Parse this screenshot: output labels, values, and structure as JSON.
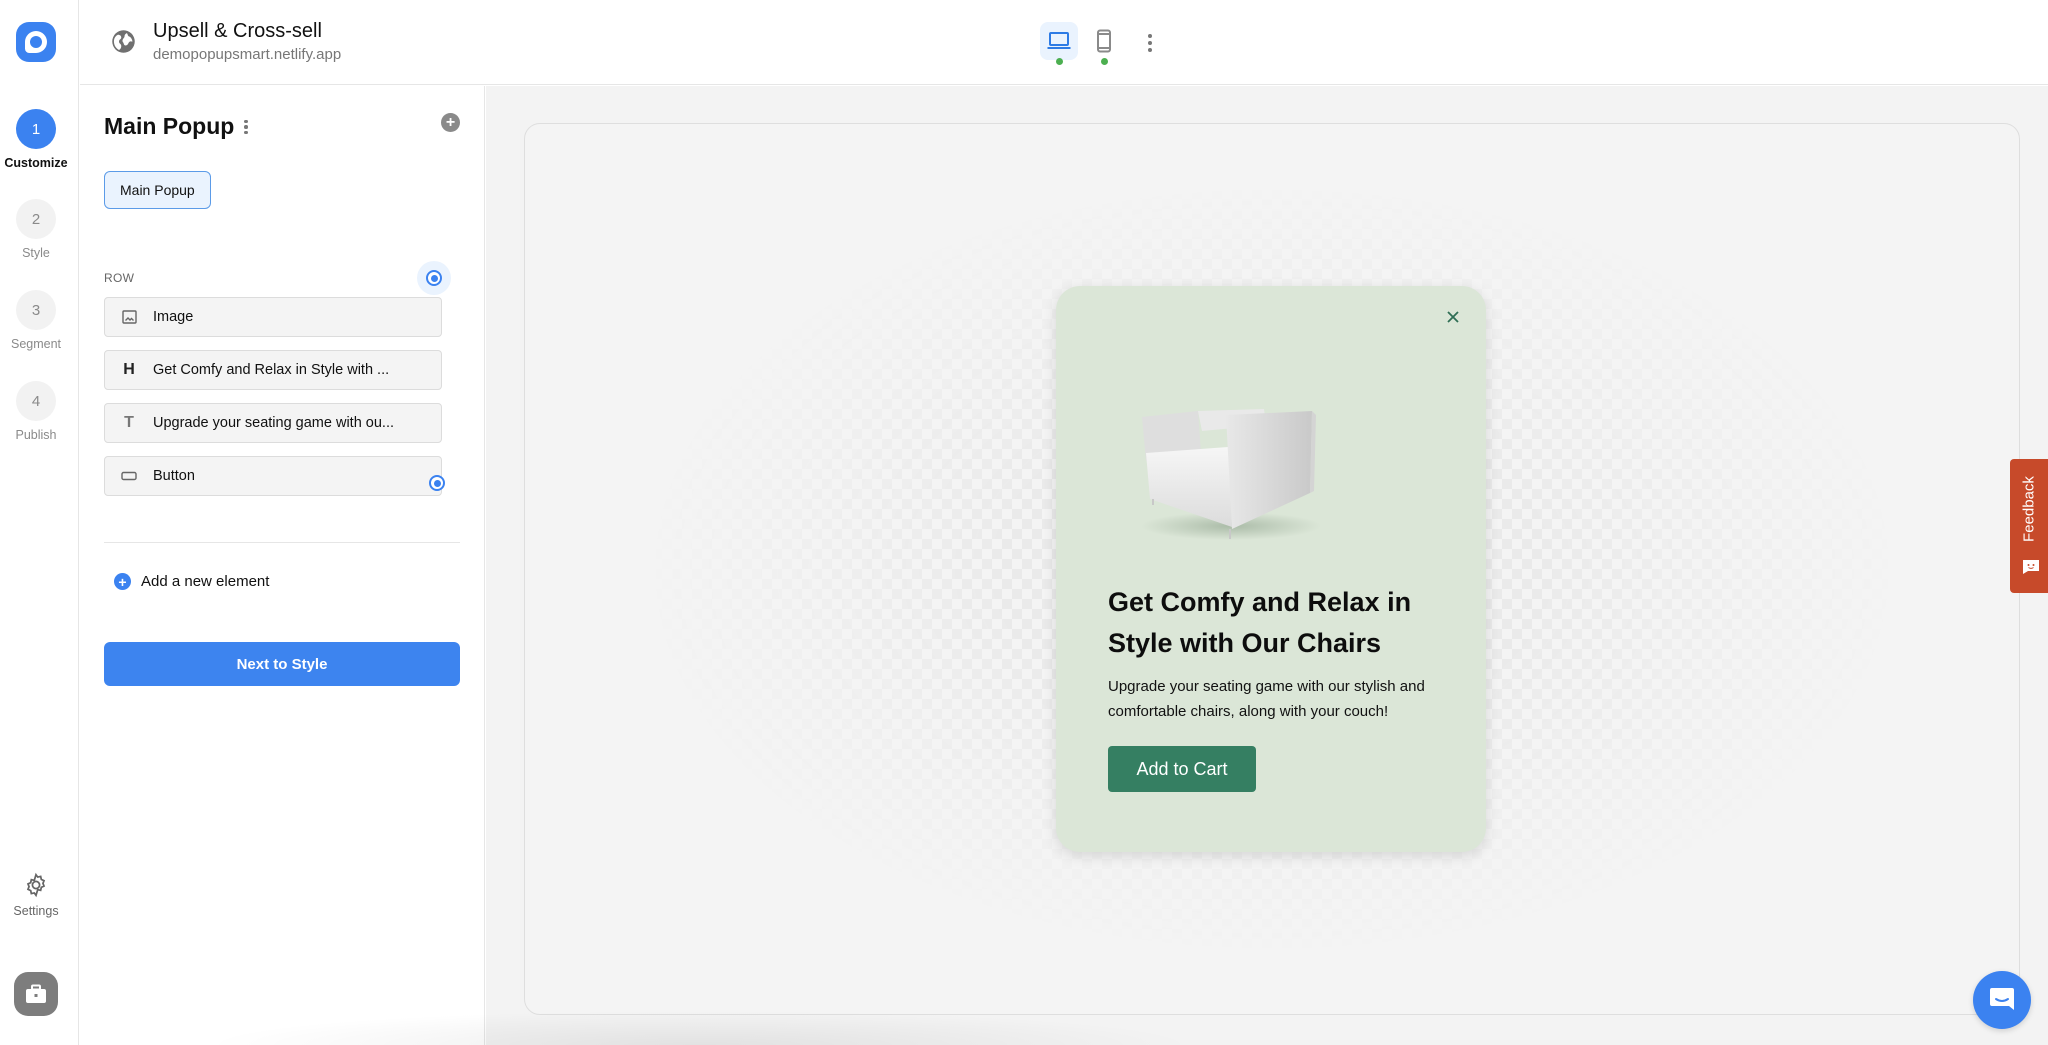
{
  "app": {
    "logo": "popupsmart-logo-icon",
    "site_title": "Upsell & Cross-sell",
    "site_domain": "demopopupsmart.netlify.app"
  },
  "rail": {
    "steps": [
      {
        "number": "1",
        "label": "Customize",
        "active": true
      },
      {
        "number": "2",
        "label": "Style",
        "active": false
      },
      {
        "number": "3",
        "label": "Segment",
        "active": false
      },
      {
        "number": "4",
        "label": "Publish",
        "active": false
      }
    ],
    "settings_label": "Settings"
  },
  "header": {
    "devices": [
      {
        "name": "desktop",
        "icon": "laptop-icon",
        "selected": true,
        "status_color": "#4caf50"
      },
      {
        "name": "mobile",
        "icon": "phone-icon",
        "selected": false,
        "status_color": "#4caf50"
      }
    ]
  },
  "panel": {
    "title": "Main Popup",
    "tabs": [
      {
        "label": "Main Popup",
        "selected": true
      }
    ],
    "row_label": "ROW",
    "elements": [
      {
        "icon": "image-icon",
        "label": "Image"
      },
      {
        "icon": "heading-icon",
        "label": "Get Comfy and Relax in Style with ..."
      },
      {
        "icon": "text-icon",
        "label": "Upgrade your seating game with ou..."
      },
      {
        "icon": "button-icon",
        "label": "Button"
      }
    ],
    "add_element_label": "Add a new element",
    "next_button_label": "Next to Style"
  },
  "popup": {
    "heading": "Get Comfy and Relax in Style with Our Chairs",
    "body": "Upgrade your seating game with our stylish and comfortable chairs, along with your couch!",
    "cta_label": "Add to Cart",
    "background_color": "#dbe6d7",
    "cta_color": "#357f62"
  },
  "widgets": {
    "feedback_label": "Feedback",
    "accent_color": "#3b82f0",
    "feedback_color": "#c74a2a"
  }
}
